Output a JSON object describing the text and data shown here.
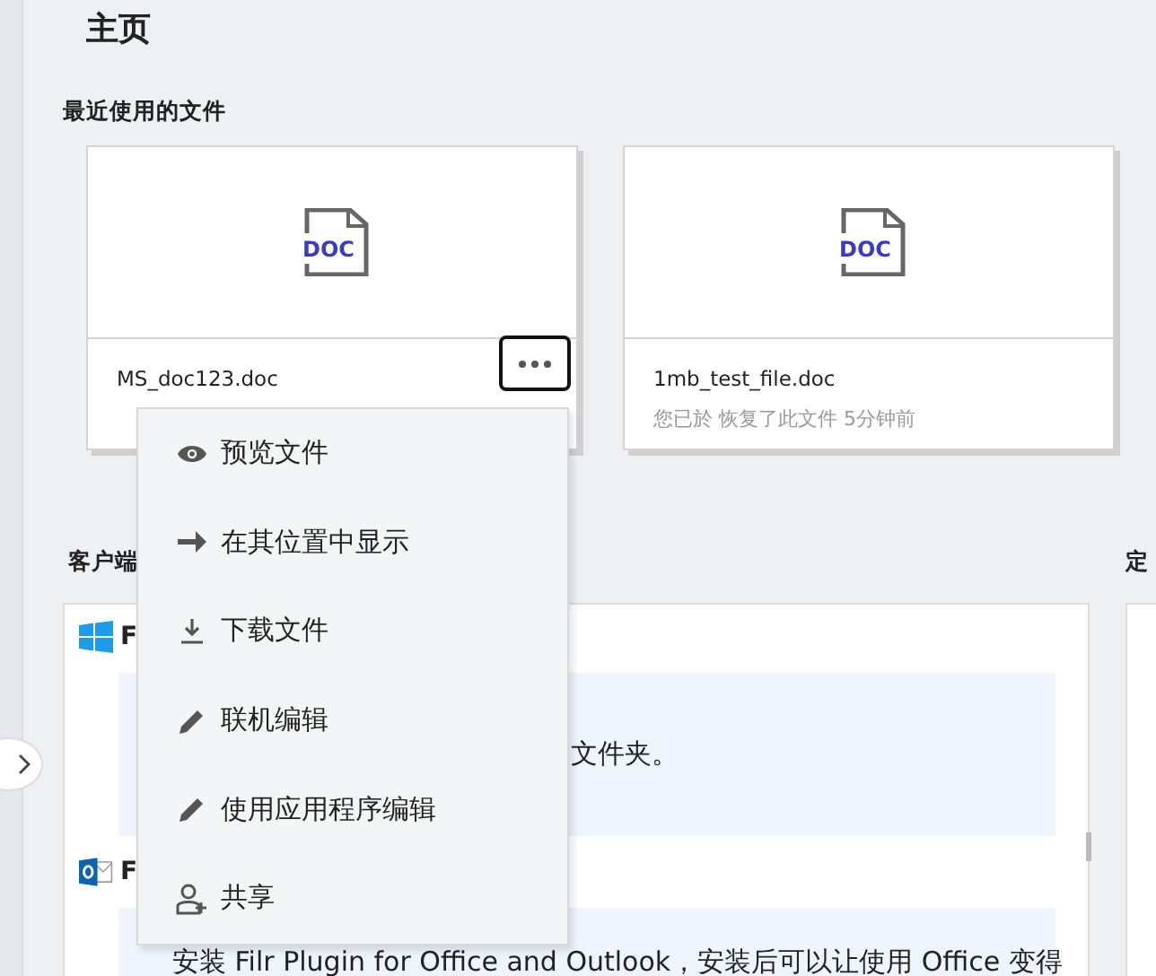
{
  "page": {
    "title": "主页"
  },
  "recent_files": {
    "heading": "最近使用的文件",
    "files": [
      {
        "name": "MS_doc123.doc",
        "type_label": "DOC",
        "menu_open": true
      },
      {
        "name": "1mb_test_file.doc",
        "type_label": "DOC",
        "activity": "您已於 恢复了此文件 5分钟前",
        "menu_open": false
      }
    ]
  },
  "context_menu": {
    "items": [
      {
        "kind": "preview",
        "label": "预览文件"
      },
      {
        "kind": "locate",
        "label": "在其位置中显示"
      },
      {
        "kind": "download",
        "label": "下载文件"
      },
      {
        "kind": "edit",
        "label": "联机编辑"
      },
      {
        "kind": "edit",
        "label": "使用应用程序编辑"
      },
      {
        "kind": "share",
        "label": "共享"
      }
    ]
  },
  "clients": {
    "heading": "客户端",
    "panels": [
      {
        "kind": "windows",
        "title": "F",
        "text": "文件夹。"
      },
      {
        "kind": "outlook",
        "title": "F",
        "text": "安装 Filr Plugin for Office and Outlook，安装后可以让使用 Office 变得"
      }
    ]
  },
  "right_section": {
    "heading": "定"
  }
}
